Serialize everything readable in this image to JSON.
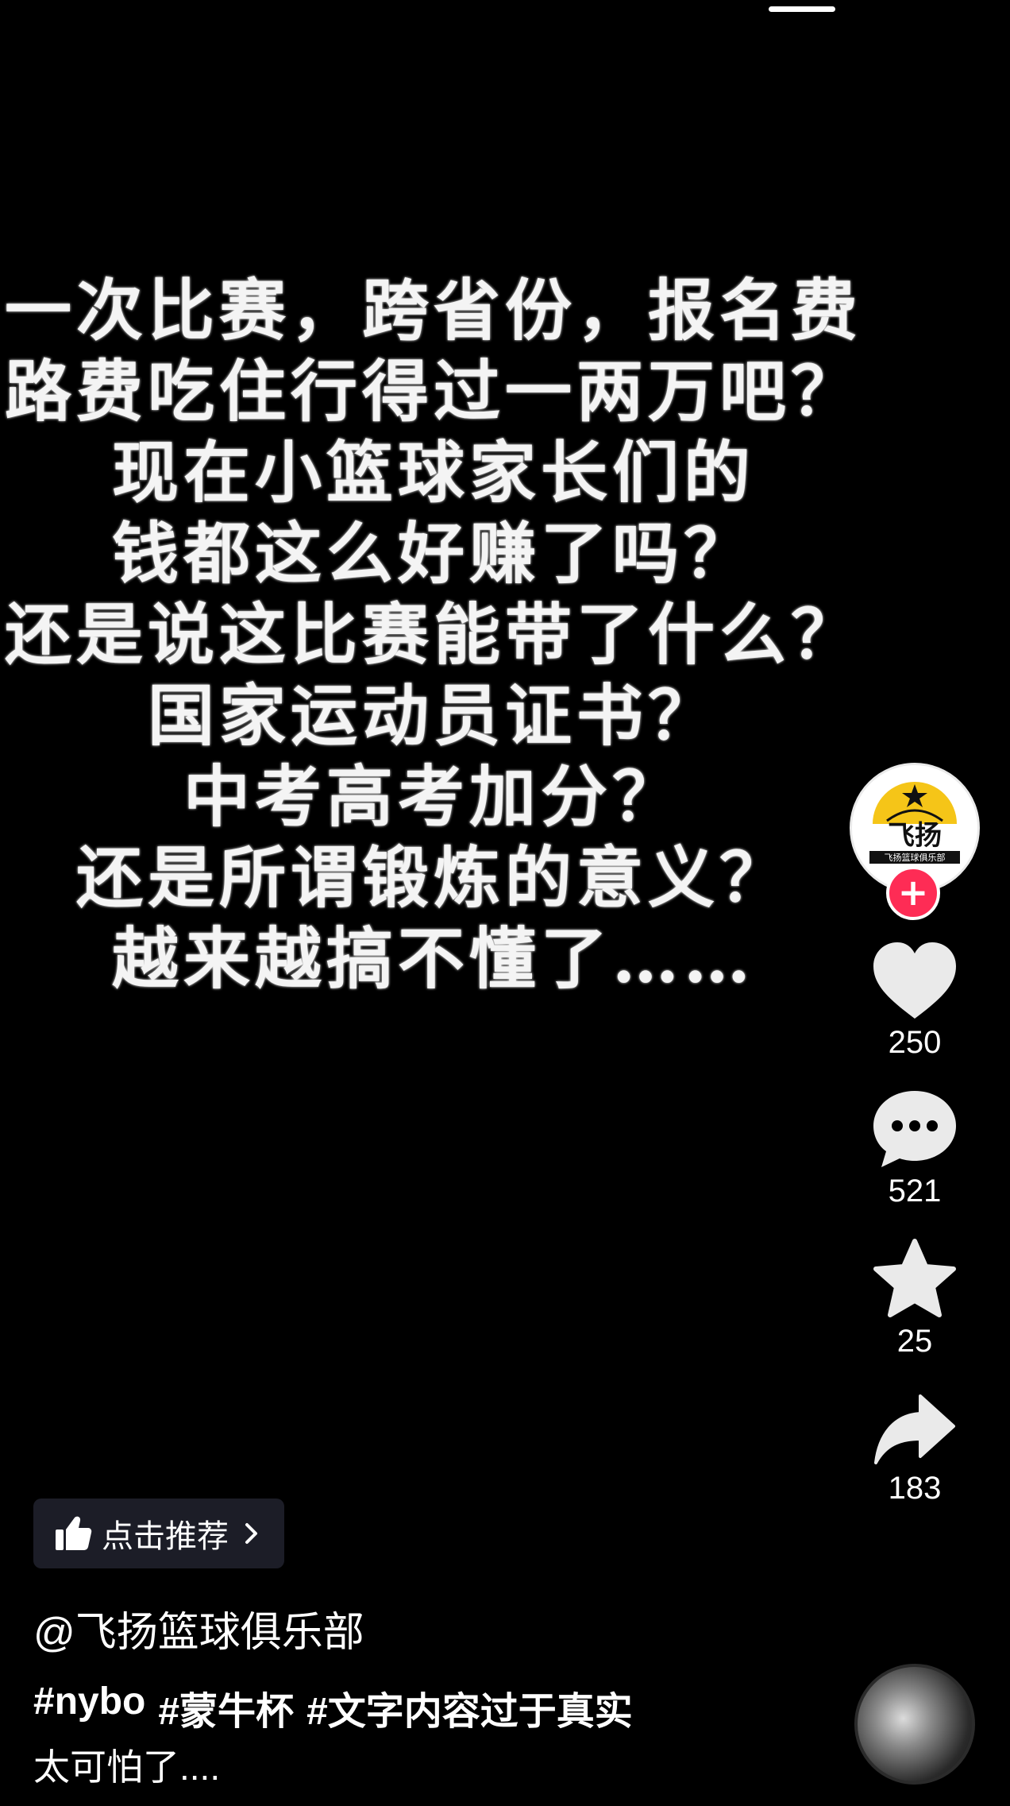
{
  "video_text": {
    "lines": [
      "一次比赛，跨省份，报名费",
      "路费吃住行得过一两万吧？",
      "现在小篮球家长们的",
      "钱都这么好赚了吗？",
      "还是说这比赛能带了什么？",
      "国家运动员证书？",
      "中考高考加分？",
      "还是所谓锻炼的意义？",
      "越来越搞不懂了……"
    ]
  },
  "creator": {
    "logo_text": "飞扬",
    "logo_subtext": "飞扬篮球俱乐部",
    "follow_icon": "plus-icon"
  },
  "actions": {
    "likes": "250",
    "comments": "521",
    "favorites": "25",
    "shares": "183"
  },
  "recommend": {
    "label": "点击推荐",
    "icon": "thumbs-up-icon"
  },
  "post": {
    "author": "@飞扬篮球俱乐部",
    "hashtags": [
      "#nybo",
      "#蒙牛杯",
      "#文字内容过于真实"
    ],
    "caption": "太可怕了...."
  },
  "colors": {
    "background": "#000000",
    "follow_accent": "#fe2c55",
    "chip_bg": "#1c1d27",
    "logo_yellow": "#f5c518"
  }
}
